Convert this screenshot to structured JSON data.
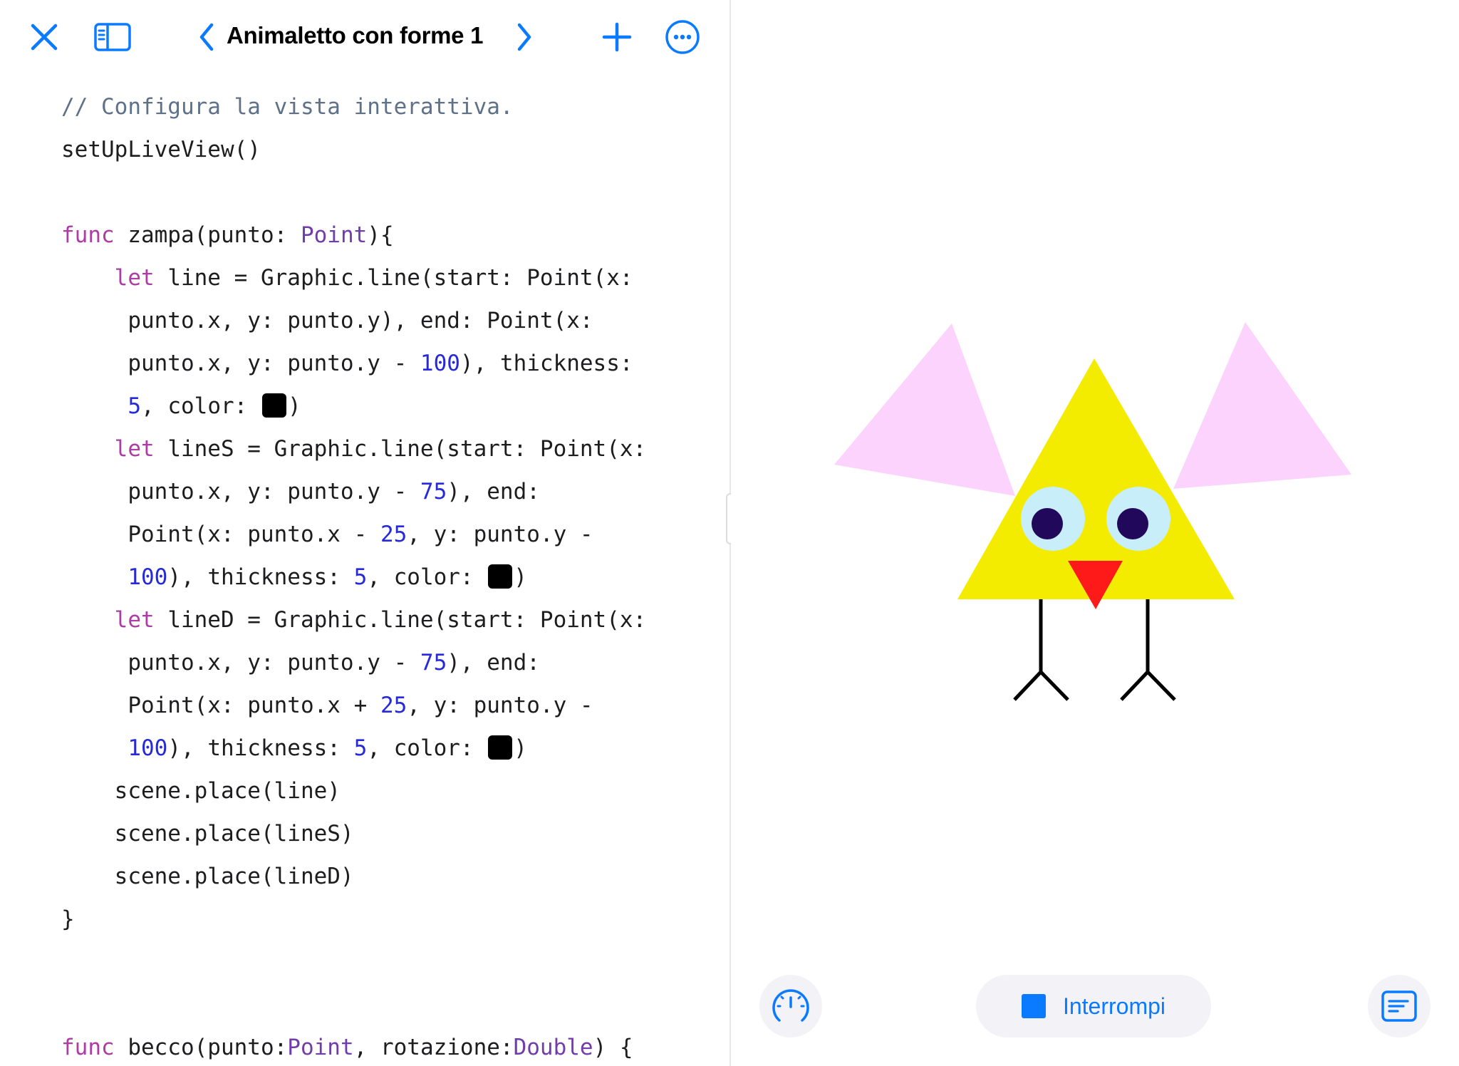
{
  "toolbar": {
    "title": "Animaletto con forme 1",
    "icons": [
      "close-icon",
      "sidebar-icon",
      "chevron-left-icon",
      "chevron-right-icon",
      "plus-icon",
      "ellipsis-circle-icon"
    ],
    "accent_color": "#0a7aff"
  },
  "code": {
    "lines": [
      [
        {
          "t": "// Configura la vista interattiva.",
          "c": "cm"
        }
      ],
      [
        {
          "t": "setUpLiveView()"
        }
      ],
      [],
      [
        {
          "t": "func",
          "c": "kw"
        },
        {
          "t": " zampa(punto: "
        },
        {
          "t": "Point",
          "c": "ty"
        },
        {
          "t": "){"
        }
      ],
      [
        {
          "t": "    "
        },
        {
          "t": "let",
          "c": "kw"
        },
        {
          "t": " line = Graphic.line(start: Point(x:"
        }
      ],
      [
        {
          "t": "     punto.x, y: punto.y), end: Point(x:"
        }
      ],
      [
        {
          "t": "     punto.x, y: punto.y - "
        },
        {
          "t": "100",
          "c": "nm"
        },
        {
          "t": "), thickness:"
        }
      ],
      [
        {
          "t": "     "
        },
        {
          "t": "5",
          "c": "nm"
        },
        {
          "t": ", color: "
        },
        {
          "sw": "#000000"
        },
        {
          "t": ")"
        }
      ],
      [
        {
          "t": "    "
        },
        {
          "t": "let",
          "c": "kw"
        },
        {
          "t": " lineS = Graphic.line(start: Point(x:"
        }
      ],
      [
        {
          "t": "     punto.x, y: punto.y - "
        },
        {
          "t": "75",
          "c": "nm"
        },
        {
          "t": "), end:"
        }
      ],
      [
        {
          "t": "     Point(x: punto.x - "
        },
        {
          "t": "25",
          "c": "nm"
        },
        {
          "t": ", y: punto.y -"
        }
      ],
      [
        {
          "t": "     "
        },
        {
          "t": "100",
          "c": "nm"
        },
        {
          "t": "), thickness: "
        },
        {
          "t": "5",
          "c": "nm"
        },
        {
          "t": ", color: "
        },
        {
          "sw": "#000000"
        },
        {
          "t": ")"
        }
      ],
      [
        {
          "t": "    "
        },
        {
          "t": "let",
          "c": "kw"
        },
        {
          "t": " lineD = Graphic.line(start: Point(x:"
        }
      ],
      [
        {
          "t": "     punto.x, y: punto.y - "
        },
        {
          "t": "75",
          "c": "nm"
        },
        {
          "t": "), end:"
        }
      ],
      [
        {
          "t": "     Point(x: punto.x + "
        },
        {
          "t": "25",
          "c": "nm"
        },
        {
          "t": ", y: punto.y -"
        }
      ],
      [
        {
          "t": "     "
        },
        {
          "t": "100",
          "c": "nm"
        },
        {
          "t": "), thickness: "
        },
        {
          "t": "5",
          "c": "nm"
        },
        {
          "t": ", color: "
        },
        {
          "sw": "#000000"
        },
        {
          "t": ")"
        }
      ],
      [
        {
          "t": "    scene.place(line)"
        }
      ],
      [
        {
          "t": "    scene.place(lineS)"
        }
      ],
      [
        {
          "t": "    scene.place(lineD)"
        }
      ],
      [
        {
          "t": "}"
        }
      ],
      [],
      [],
      [
        {
          "t": "func",
          "c": "kw"
        },
        {
          "t": " becco(punto:"
        },
        {
          "t": "Point",
          "c": "ty"
        },
        {
          "t": ", rotazione:"
        },
        {
          "t": "Double",
          "c": "ty"
        },
        {
          "t": ") {"
        }
      ]
    ]
  },
  "liveview": {
    "colors": {
      "ears": "#fcd3fc",
      "body": "#f3ec00",
      "eye_white": "#c8eefa",
      "pupil": "#22085a",
      "beak": "#ff1a1a",
      "legs": "#000000"
    }
  },
  "bottom_bar": {
    "speed_icon": "speedometer-icon",
    "stop_icon": "stop-square-icon",
    "stop_label": "Interrompi",
    "console_icon": "console-icon"
  }
}
